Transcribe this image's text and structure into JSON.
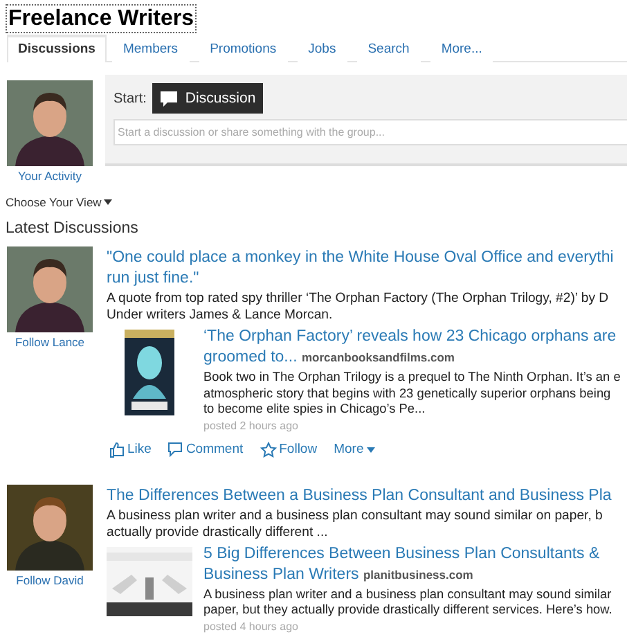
{
  "group_title": "Freelance Writers",
  "tabs": [
    {
      "label": "Discussions",
      "selected": true
    },
    {
      "label": "Members",
      "selected": false
    },
    {
      "label": "Promotions",
      "selected": false
    },
    {
      "label": "Jobs",
      "selected": false
    },
    {
      "label": "Search",
      "selected": false
    },
    {
      "label": "More...",
      "selected": false
    }
  ],
  "composer": {
    "avatar_caption": "Your Activity",
    "start_label": "Start:",
    "discussion_button": "Discussion",
    "placeholder": "Start a discussion or share something with the group..."
  },
  "view_menu": "Choose Your View",
  "section_title": "Latest Discussions",
  "posts": [
    {
      "follow": "Follow Lance",
      "title": "\"One could place a monkey in the White House Oval Office and everythi\nrun just fine.\"",
      "summary": "A quote from top rated spy thriller ‘The Orphan Factory (The Orphan Trilogy, #2)’ by D\nUnder writers James & Lance Morcan.",
      "link": {
        "title": "‘The Orphan Factory’ reveals how 23 Chicago orphans are\ngroomed to...",
        "source": "morcanbooksandfilms.com",
        "summary": "Book two in The Orphan Trilogy is a prequel to The Ninth Orphan. It’s an e\natmospheric story that begins with 23 genetically superior orphans being\nto become elite spies in Chicago’s Pe...",
        "kind": "book"
      },
      "posted": "posted 2 hours ago",
      "actions": [
        "Like",
        "Comment",
        "Follow",
        "More"
      ]
    },
    {
      "follow": "Follow David",
      "title": "The Differences Between a Business Plan Consultant and Business Pla",
      "summary": "A business plan writer and a business plan consultant may sound similar on paper, b\nactually provide drastically different ...",
      "link": {
        "title": "5 Big Differences Between Business Plan Consultants &\nBusiness Plan Writers",
        "source": "planitbusiness.com",
        "summary": "A business plan writer and a business plan consultant may sound similar\npaper, but they actually provide drastically different services. Here’s how.",
        "kind": "typewriter"
      },
      "posted": "posted 4 hours ago"
    }
  ]
}
